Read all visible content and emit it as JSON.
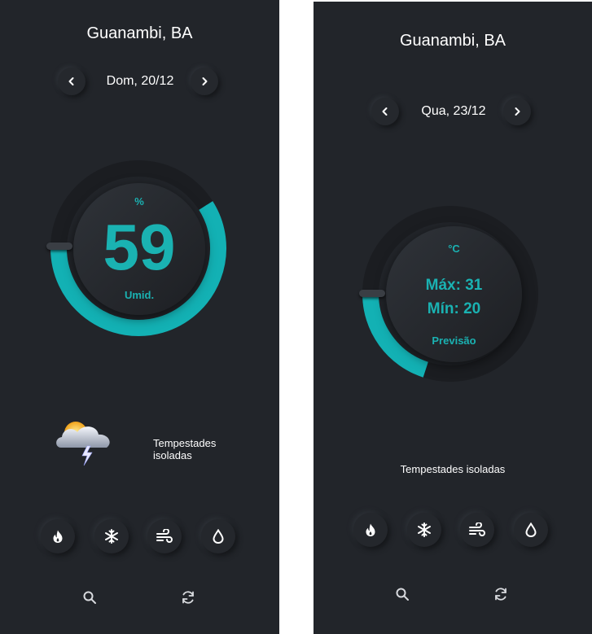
{
  "screens": [
    {
      "city": "Guanambi, BA",
      "date": "Dom, 20/12",
      "gauge": {
        "unit": "%",
        "value": "59",
        "label": "Umid.",
        "fill_fraction": 0.59
      },
      "weather": {
        "description": "Tempestades isoladas",
        "icon": "storm-cloud-icon"
      }
    },
    {
      "city": "Guanambi, BA",
      "date": "Qua, 23/12",
      "gauge": {
        "unit": "°C",
        "max": "Máx: 31",
        "min": "Mín: 20",
        "label": "Previsão",
        "fill_fraction": 0.2
      },
      "weather": {
        "description": "Tempestades isoladas"
      }
    }
  ],
  "action_buttons": [
    "flame-icon",
    "snowflake-icon",
    "wind-icon",
    "water-drop-icon"
  ],
  "bottom_icons": [
    "search-icon",
    "refresh-icon"
  ],
  "colors": {
    "background": "#22252a",
    "accent": "#1ab2b2",
    "text": "#ffffff"
  }
}
